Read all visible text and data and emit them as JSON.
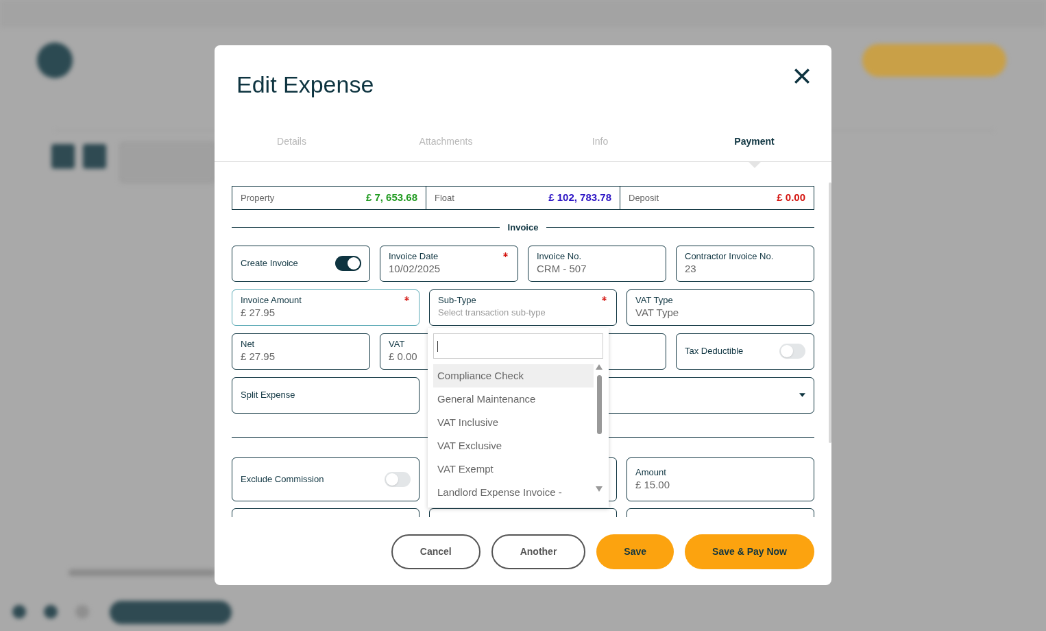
{
  "dialog": {
    "title": "Edit Expense"
  },
  "tabs": [
    {
      "label": "Details",
      "selected": false
    },
    {
      "label": "Attachments",
      "selected": false
    },
    {
      "label": "Info",
      "selected": false
    },
    {
      "label": "Payment",
      "selected": true
    }
  ],
  "balances": [
    {
      "label": "Property",
      "value": "£ 7, 653.68",
      "color": "#1f9a1f"
    },
    {
      "label": "Float",
      "value": "£ 102, 783.78",
      "color": "#2a12c4"
    },
    {
      "label": "Deposit",
      "value": "£ 0.00",
      "color": "#d4140f"
    }
  ],
  "section_title": "Invoice",
  "row_1": [
    {
      "kind": "toggle",
      "label": "Create Invoice",
      "on": true
    },
    {
      "kind": "field",
      "label": "Invoice Date",
      "value": "10/02/2025",
      "required": true
    },
    {
      "kind": "field",
      "label": "Invoice No.",
      "value": "CRM - 507",
      "required": false
    },
    {
      "kind": "field",
      "label": "Contractor Invoice No.",
      "value": "23",
      "required": false
    }
  ],
  "row_2": [
    {
      "kind": "field",
      "label": "Invoice Amount",
      "value": "£ 27.95",
      "required": true,
      "focused": true
    },
    {
      "kind": "field",
      "label": "Sub-Type",
      "placeholder": "Select transaction sub-type",
      "required": true,
      "focused": false
    },
    {
      "kind": "field",
      "label": "VAT Type",
      "value": "VAT Type",
      "required": false,
      "focused": false
    }
  ],
  "row_3": [
    {
      "kind": "field",
      "label": "Net",
      "value": "£ 27.95"
    },
    {
      "kind": "field",
      "label": "VAT",
      "value": "£ 0.00"
    },
    {
      "kind": "blank"
    },
    {
      "kind": "toggle",
      "label": "Tax Deductible",
      "on": false
    }
  ],
  "split_expense": {
    "label": "Split Expense"
  },
  "row_5": [
    {
      "kind": "toggle",
      "label": "Exclude Commission",
      "on": false
    },
    {
      "kind": "blank"
    },
    {
      "kind": "field",
      "label": "Amount",
      "value": "£ 15.00"
    }
  ],
  "dropdown": {
    "options": [
      {
        "label": "Compliance Check",
        "selected": true
      },
      {
        "label": "General Maintenance",
        "selected": false
      },
      {
        "label": "VAT Inclusive",
        "selected": false
      },
      {
        "label": "VAT Exclusive",
        "selected": false
      },
      {
        "label": "VAT Exempt",
        "selected": false
      },
      {
        "label": "Landlord Expense Invoice -",
        "selected": false
      }
    ]
  },
  "buttons": [
    {
      "label": "Cancel",
      "kind": "outline"
    },
    {
      "label": "Another",
      "kind": "outline"
    },
    {
      "label": "Save",
      "kind": "primary"
    },
    {
      "label": "Save & Pay Now",
      "kind": "primary"
    }
  ]
}
